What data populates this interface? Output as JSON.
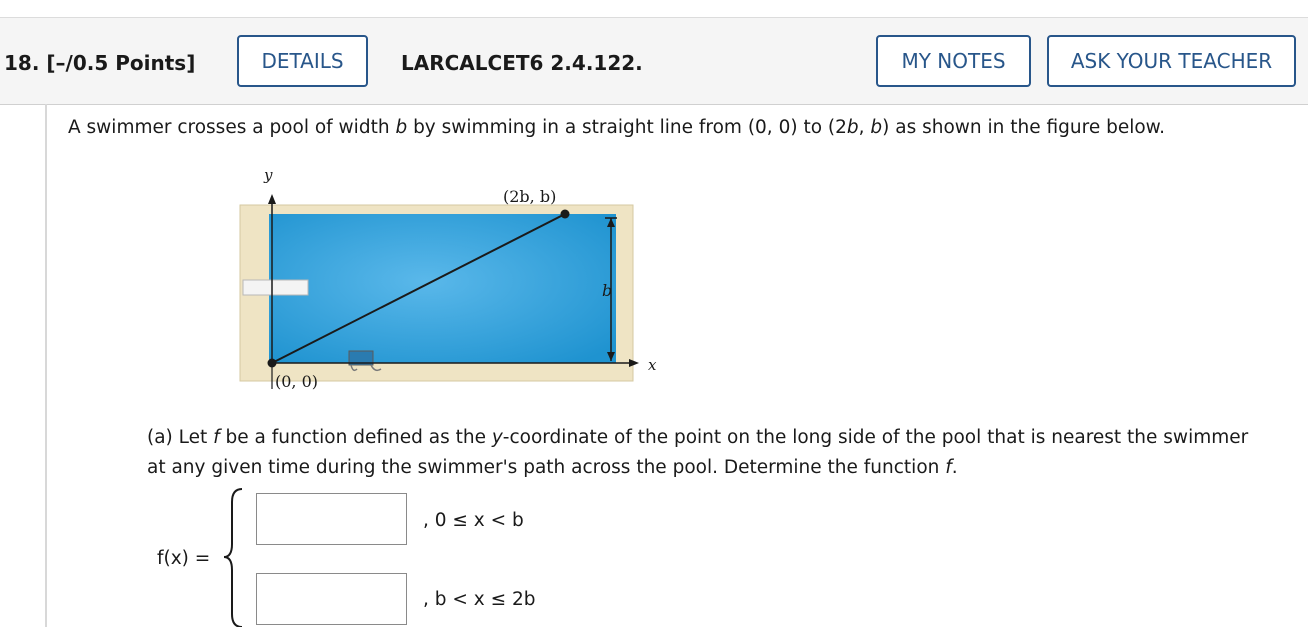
{
  "question": {
    "number": "18.",
    "points": "[–/0.5 Points]",
    "details_label": "DETAILS",
    "code": "LARCALCET6 2.4.122.",
    "my_notes_label": "MY NOTES",
    "ask_teacher_label": "ASK YOUR TEACHER"
  },
  "prompt": {
    "p1": "A swimmer crosses a pool of width ",
    "p2": "b",
    "p3": " by swimming in a straight line from (0, 0) to (2",
    "p4": "b",
    "p5": ", ",
    "p6": "b",
    "p7": ") as shown in the figure below."
  },
  "figure": {
    "y_label": "y",
    "x_label": "x",
    "endpoint_label": "(2b, b)",
    "origin_label": "(0, 0)",
    "width_label": "b",
    "colors": {
      "water": "#2a9fd8",
      "deck": "#efe4c4",
      "line": "#1a1a1a"
    }
  },
  "part_a": {
    "t1": "(a) Let ",
    "t2": "f",
    "t3": " be a function defined as the ",
    "t4": "y",
    "t5": "-coordinate of the point on the long side of the pool that is nearest the swimmer at any given time during the swimmer's path across the pool. Determine the function ",
    "t6": "f",
    "t7": "."
  },
  "piecewise": {
    "f_label": "f(x)  =",
    "piece1_value": "",
    "piece1_condition": ", 0 ≤ x < b",
    "piece2_value": "",
    "piece2_condition": ", b < x ≤ 2b"
  }
}
